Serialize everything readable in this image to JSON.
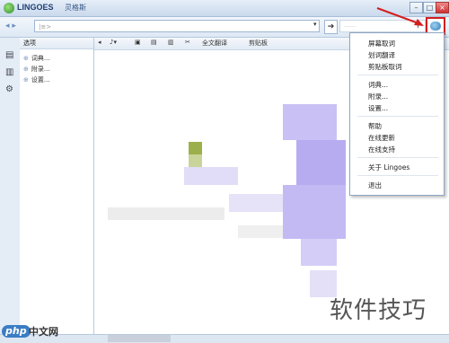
{
  "window": {
    "app_name": "LINGOES",
    "app_name_cn": "灵格斯",
    "min": "–",
    "max": "□",
    "close": "×"
  },
  "toolbar": {
    "back": "◂ ▸",
    "search_placeholder": "|≡>",
    "dropdown": "▾",
    "go": "➔",
    "web_search_placeholder": "······",
    "web_search_icon": "⚲"
  },
  "left_strip": {
    "icons": [
      "dictionary-icon",
      "book-icon",
      "settings-icon"
    ]
  },
  "side_panel": {
    "header": "选项",
    "items": [
      "词典...",
      "附录...",
      "设置..."
    ]
  },
  "content_toolbar": {
    "items": [
      "◂",
      "♪▾",
      "▣",
      "▤",
      "▥",
      "✂",
      "全文翻译",
      "剪贴板"
    ]
  },
  "popup_menu": {
    "items": [
      "屏幕取词",
      "划词翻译",
      "剪贴板取词",
      "词典...",
      "附录...",
      "设置...",
      "帮助",
      "在线更新",
      "在线支持",
      "关于 Lingoes",
      "退出"
    ]
  },
  "watermark": {
    "text": "软件技巧",
    "badge": "php",
    "badge_cn": "中文网"
  },
  "colors": {
    "highlight_box": "#d41e1e",
    "blur_purple": "#b7acf0",
    "blur_green": "#9bb04a"
  }
}
